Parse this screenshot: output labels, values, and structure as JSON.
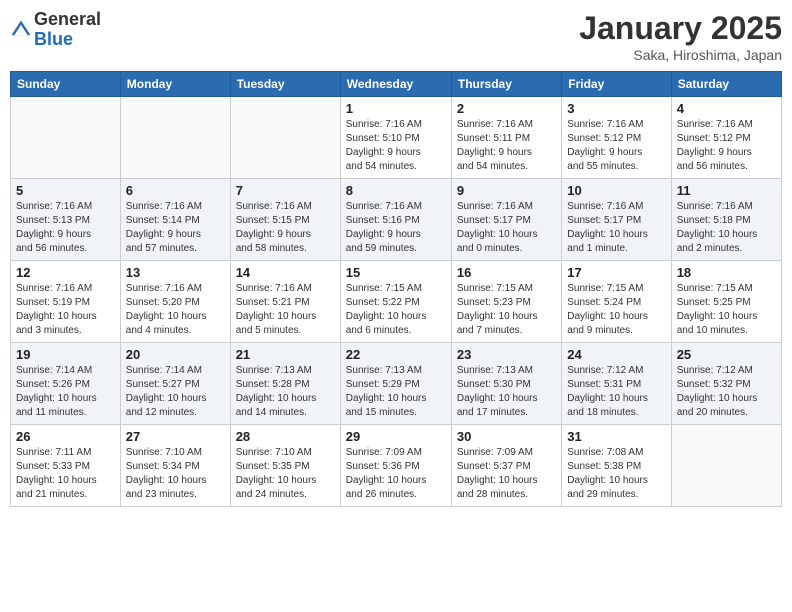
{
  "header": {
    "logo_general": "General",
    "logo_blue": "Blue",
    "title": "January 2025",
    "subtitle": "Saka, Hiroshima, Japan"
  },
  "weekdays": [
    "Sunday",
    "Monday",
    "Tuesday",
    "Wednesday",
    "Thursday",
    "Friday",
    "Saturday"
  ],
  "weeks": [
    [
      {
        "day": "",
        "info": ""
      },
      {
        "day": "",
        "info": ""
      },
      {
        "day": "",
        "info": ""
      },
      {
        "day": "1",
        "info": "Sunrise: 7:16 AM\nSunset: 5:10 PM\nDaylight: 9 hours\nand 54 minutes."
      },
      {
        "day": "2",
        "info": "Sunrise: 7:16 AM\nSunset: 5:11 PM\nDaylight: 9 hours\nand 54 minutes."
      },
      {
        "day": "3",
        "info": "Sunrise: 7:16 AM\nSunset: 5:12 PM\nDaylight: 9 hours\nand 55 minutes."
      },
      {
        "day": "4",
        "info": "Sunrise: 7:16 AM\nSunset: 5:12 PM\nDaylight: 9 hours\nand 56 minutes."
      }
    ],
    [
      {
        "day": "5",
        "info": "Sunrise: 7:16 AM\nSunset: 5:13 PM\nDaylight: 9 hours\nand 56 minutes."
      },
      {
        "day": "6",
        "info": "Sunrise: 7:16 AM\nSunset: 5:14 PM\nDaylight: 9 hours\nand 57 minutes."
      },
      {
        "day": "7",
        "info": "Sunrise: 7:16 AM\nSunset: 5:15 PM\nDaylight: 9 hours\nand 58 minutes."
      },
      {
        "day": "8",
        "info": "Sunrise: 7:16 AM\nSunset: 5:16 PM\nDaylight: 9 hours\nand 59 minutes."
      },
      {
        "day": "9",
        "info": "Sunrise: 7:16 AM\nSunset: 5:17 PM\nDaylight: 10 hours\nand 0 minutes."
      },
      {
        "day": "10",
        "info": "Sunrise: 7:16 AM\nSunset: 5:17 PM\nDaylight: 10 hours\nand 1 minute."
      },
      {
        "day": "11",
        "info": "Sunrise: 7:16 AM\nSunset: 5:18 PM\nDaylight: 10 hours\nand 2 minutes."
      }
    ],
    [
      {
        "day": "12",
        "info": "Sunrise: 7:16 AM\nSunset: 5:19 PM\nDaylight: 10 hours\nand 3 minutes."
      },
      {
        "day": "13",
        "info": "Sunrise: 7:16 AM\nSunset: 5:20 PM\nDaylight: 10 hours\nand 4 minutes."
      },
      {
        "day": "14",
        "info": "Sunrise: 7:16 AM\nSunset: 5:21 PM\nDaylight: 10 hours\nand 5 minutes."
      },
      {
        "day": "15",
        "info": "Sunrise: 7:15 AM\nSunset: 5:22 PM\nDaylight: 10 hours\nand 6 minutes."
      },
      {
        "day": "16",
        "info": "Sunrise: 7:15 AM\nSunset: 5:23 PM\nDaylight: 10 hours\nand 7 minutes."
      },
      {
        "day": "17",
        "info": "Sunrise: 7:15 AM\nSunset: 5:24 PM\nDaylight: 10 hours\nand 9 minutes."
      },
      {
        "day": "18",
        "info": "Sunrise: 7:15 AM\nSunset: 5:25 PM\nDaylight: 10 hours\nand 10 minutes."
      }
    ],
    [
      {
        "day": "19",
        "info": "Sunrise: 7:14 AM\nSunset: 5:26 PM\nDaylight: 10 hours\nand 11 minutes."
      },
      {
        "day": "20",
        "info": "Sunrise: 7:14 AM\nSunset: 5:27 PM\nDaylight: 10 hours\nand 12 minutes."
      },
      {
        "day": "21",
        "info": "Sunrise: 7:13 AM\nSunset: 5:28 PM\nDaylight: 10 hours\nand 14 minutes."
      },
      {
        "day": "22",
        "info": "Sunrise: 7:13 AM\nSunset: 5:29 PM\nDaylight: 10 hours\nand 15 minutes."
      },
      {
        "day": "23",
        "info": "Sunrise: 7:13 AM\nSunset: 5:30 PM\nDaylight: 10 hours\nand 17 minutes."
      },
      {
        "day": "24",
        "info": "Sunrise: 7:12 AM\nSunset: 5:31 PM\nDaylight: 10 hours\nand 18 minutes."
      },
      {
        "day": "25",
        "info": "Sunrise: 7:12 AM\nSunset: 5:32 PM\nDaylight: 10 hours\nand 20 minutes."
      }
    ],
    [
      {
        "day": "26",
        "info": "Sunrise: 7:11 AM\nSunset: 5:33 PM\nDaylight: 10 hours\nand 21 minutes."
      },
      {
        "day": "27",
        "info": "Sunrise: 7:10 AM\nSunset: 5:34 PM\nDaylight: 10 hours\nand 23 minutes."
      },
      {
        "day": "28",
        "info": "Sunrise: 7:10 AM\nSunset: 5:35 PM\nDaylight: 10 hours\nand 24 minutes."
      },
      {
        "day": "29",
        "info": "Sunrise: 7:09 AM\nSunset: 5:36 PM\nDaylight: 10 hours\nand 26 minutes."
      },
      {
        "day": "30",
        "info": "Sunrise: 7:09 AM\nSunset: 5:37 PM\nDaylight: 10 hours\nand 28 minutes."
      },
      {
        "day": "31",
        "info": "Sunrise: 7:08 AM\nSunset: 5:38 PM\nDaylight: 10 hours\nand 29 minutes."
      },
      {
        "day": "",
        "info": ""
      }
    ]
  ]
}
